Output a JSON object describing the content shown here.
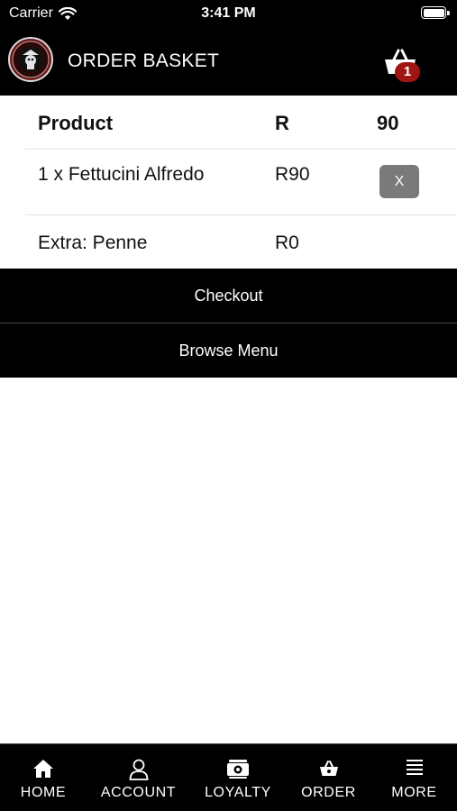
{
  "status_bar": {
    "carrier": "Carrier",
    "time": "3:41 PM"
  },
  "header": {
    "title": "ORDER BASKET",
    "basket_count": "1"
  },
  "basket": {
    "columns": [
      "Product",
      "R",
      "90"
    ],
    "items": [
      {
        "name": "1 x Fettucini Alfredo",
        "price": "R90",
        "remove_label": "X"
      },
      {
        "name": "Extra: Penne",
        "price": "R0"
      }
    ]
  },
  "actions": {
    "checkout": "Checkout",
    "browse_menu": "Browse Menu"
  },
  "tab_bar": {
    "tabs": [
      {
        "label": "HOME",
        "icon": "home-icon"
      },
      {
        "label": "ACCOUNT",
        "icon": "user-icon"
      },
      {
        "label": "LOYALTY",
        "icon": "loyalty-card-icon"
      },
      {
        "label": "ORDER",
        "icon": "basket-icon"
      },
      {
        "label": "MORE",
        "icon": "menu-icon"
      }
    ]
  },
  "colors": {
    "bar_background": "#000000",
    "badge": "#a01414",
    "remove_button": "#7a7a7a"
  }
}
